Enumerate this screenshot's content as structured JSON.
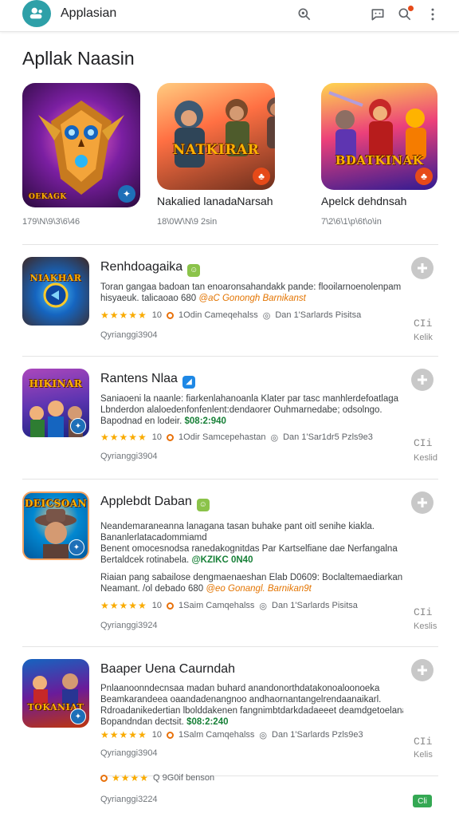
{
  "app": {
    "title": "Applasian"
  },
  "colors": {
    "accent": "#2ea0a8",
    "star": "#f9ab00",
    "orange": "#e37400",
    "green": "#188038"
  },
  "toolbar": {
    "icons": [
      "search-icon",
      "chat-icon",
      "notification-search-icon",
      "more-vert-icon"
    ]
  },
  "section": {
    "title": "Apllak Naasin"
  },
  "featured": [
    {
      "art_text": "OEKAGK",
      "name": "",
      "meta": "179\\N\\9\\3\\6\\46",
      "badge_color": "#1e6fb8",
      "icon": "robot-owl-art"
    },
    {
      "art_text": "NATKIRAR",
      "name": "Nakalied lanadaNarsah",
      "meta": "18\\0W\\N\\9 2sin",
      "badge_color": "#e64a19",
      "icon": "soldiers-art"
    },
    {
      "art_text": "BDATKINAK",
      "name": "Apelck dehdnsah",
      "meta": "7\\2\\6\\1\\p\\6t\\o\\in",
      "badge_color": "#e64a19",
      "icon": "heroes-art"
    }
  ],
  "list": [
    {
      "title": "Renhdoagaika",
      "title_icon_color": "#8bc34a",
      "icon_text": "NIAKHAR",
      "desc_1": "Toran gangaa badoan tan enoaronsahandakk pande: flooilarnoenolenpam",
      "desc_2_pre": "hisyaeuk. talicaoao 680",
      "desc_2_hl": "@aC Gonongh Barnikanst",
      "desc_2_hl_type": "orange",
      "desc_3": "",
      "desc_4_pre": "",
      "desc_4_hl": "",
      "stars": "★★★★★",
      "count": "10",
      "dev": "1Odin Cameqehalss",
      "location": "Dan 1'Sarlards Pisitsa",
      "small": "Qyrianggi3904",
      "mark": "CIi",
      "mark_sub": "Kelik"
    },
    {
      "title": "Rantens Nlaa",
      "title_icon_color": "#1e88e5",
      "icon_text": "HIKINAR",
      "desc_1": "Saniaoeni la naanle: fiarkenlahanoanla Klater par tasc manhlerdefoatlaga",
      "desc_2_pre": "Lbnderdon alaloedenfonfenlent:dendaorer Ouhmarnedabe; odsolngo.",
      "desc_2_hl": "",
      "desc_2_hl_type": "",
      "desc_3_pre": "Bapodnad en lodeir.",
      "desc_3_hl": "$08:2:940",
      "stars": "★★★★★",
      "count": "10",
      "dev": "1Odir Samcepehastan",
      "location": "Dan 1'Sar1dr5 Pzls9e3",
      "small": "Qyrianggi3904",
      "mark": "CIi",
      "mark_sub": "Keslid"
    },
    {
      "title": "Applebdt Daban",
      "title_icon_color": "#8bc34a",
      "icon_text": "DEICSOAN",
      "desc_1": "Neandemaraneanna lanagana tasan buhake pant oitl senihe kiakla.",
      "desc_2_pre": "Bananlerlatacadommiamd",
      "desc_2_hl": "",
      "desc_3": "Benent omocesnodsa ranedakognitdas Par Kartselfiane dae Nerfangalna",
      "desc_4_pre": "Bertaldcek rotinabela.",
      "desc_4_hl": "@KZIKC 0N40",
      "desc_5": "Riaian pang sabailose dengmaenaeshan Elab D0609: Boclaltemaediarkan",
      "desc_6_pre": "Neamant. /ol debado 680",
      "desc_6_hl": "@eo Gonangl. Barnikan9t",
      "stars": "★★★★★",
      "count": "10",
      "dev": "1Saim Camqehalss",
      "location": "Dan 1'Sarlards Pisitsa",
      "small": "Qyrianggi3924",
      "mark": "CIi",
      "mark_sub": "Keslis"
    },
    {
      "title": "Baaper Uena Caurndah",
      "title_icon_color": "",
      "icon_text": "TOKANIAT",
      "desc_1": "Pnlaanoonndecnsaa madan buhard anandonorthdatakonoaloonoeka",
      "desc_2_pre": "Beamkarandeea oaandadenangnoo andhaornantangelrendaanaikarl.",
      "desc_2_hl": "",
      "desc_3": "Rdroadanikedertian lbolddakenen fangnimbtdarkdadaeeet deamdgetoelana",
      "desc_4_pre": "Bopandndan dectsit.",
      "desc_4_hl": "$08:2:240",
      "stars": "★★★★★",
      "count": "10",
      "dev": "1Salm Camqehalss",
      "location": "Dan 1'Sarlards Pzls9e3",
      "small": "Qyrianggi3904",
      "mark": "CIi",
      "mark_sub": "Kelis"
    }
  ],
  "bottom": {
    "stars": "★★★★",
    "label": "Q 9G0if benson",
    "meta": "Qyrianggi3224",
    "badge": "Cli"
  }
}
